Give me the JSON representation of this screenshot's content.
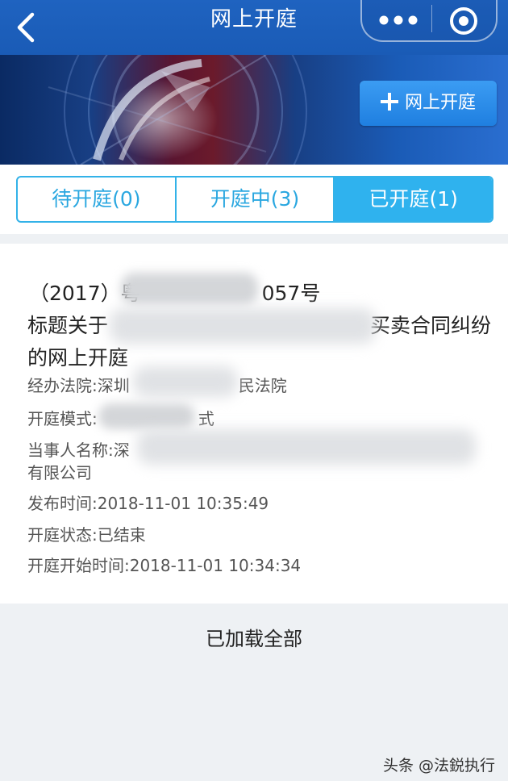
{
  "nav": {
    "title": "网上开庭"
  },
  "banner": {
    "add_button_label": "网上开庭"
  },
  "tabs": [
    {
      "label": "待开庭(0)",
      "active": false
    },
    {
      "label": "开庭中(3)",
      "active": false
    },
    {
      "label": "已开庭(1)",
      "active": true
    }
  ],
  "card": {
    "case_no_prefix": "（2017）粤",
    "case_no_suffix": "057号",
    "title_start": "标题关于",
    "title_end": "买卖合同纠纷",
    "title_line2": "的网上开庭",
    "court_prefix": "经办法院:深圳",
    "court_suffix": "民法院",
    "mode_prefix": "开庭模式:",
    "mode_suffix": "式",
    "party_prefix": "当事人名称:深",
    "party_line2": "有限公司",
    "publish_time": "发布时间:2018-11-01 10:35:49",
    "status": "开庭状态:已结束",
    "start_time": "开庭开始时间:2018-11-01 10:34:34"
  },
  "footer": {
    "loaded_text": "已加载全部"
  },
  "watermark": "头条 @法鋭执行",
  "colors": {
    "nav": "#1f63c0",
    "tab_accent": "#2fb2ee",
    "button": "#2a8ae8"
  }
}
